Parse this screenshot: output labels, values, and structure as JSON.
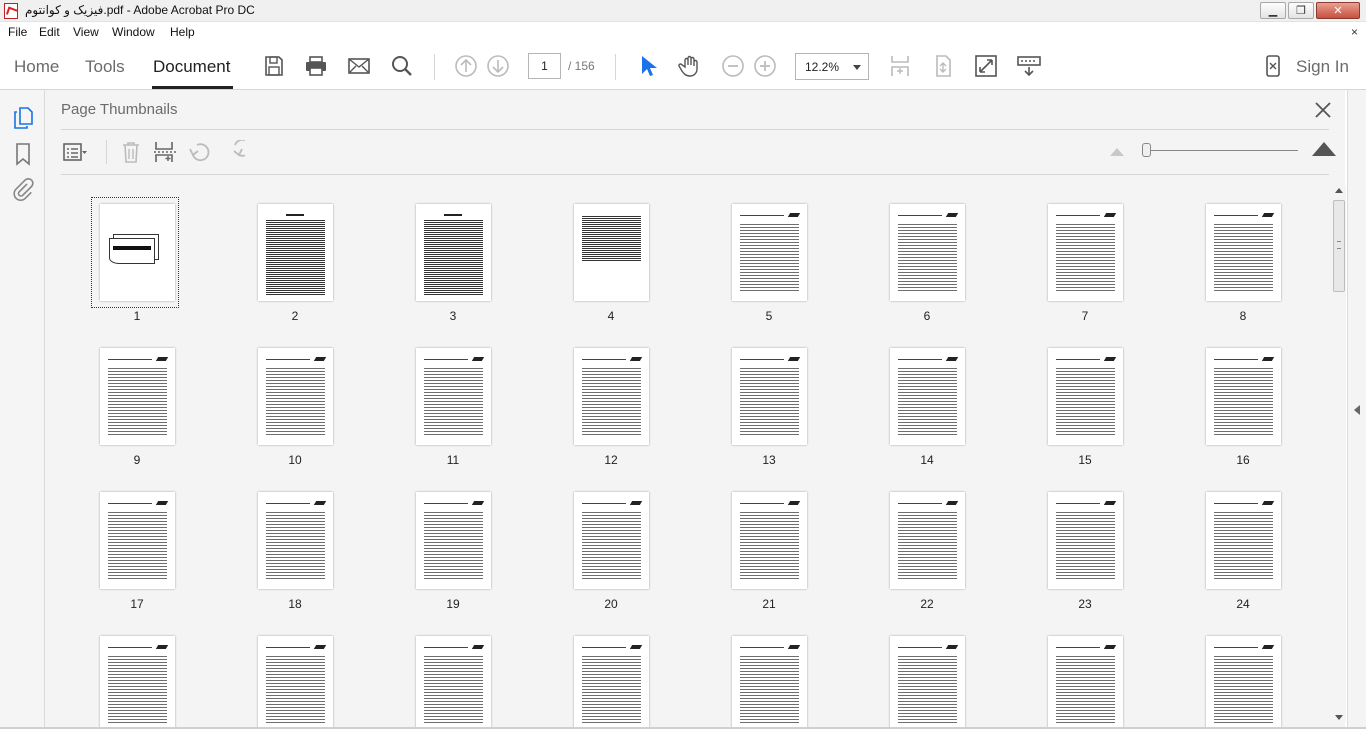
{
  "window": {
    "title": "فیزیک و کوانتوم.pdf - Adobe Acrobat Pro DC",
    "minimize": "▁",
    "maximize": "❐",
    "close": "✕"
  },
  "menubar": {
    "items": [
      "File",
      "Edit",
      "View",
      "Window",
      "Help"
    ],
    "close_glyph": "×"
  },
  "toolbar": {
    "tabs": [
      "Home",
      "Tools",
      "Document"
    ],
    "active_tab": "Document",
    "current_page": "1",
    "total_pages": "/ 156",
    "zoom": "12.2%",
    "sign_in": "Sign In",
    "icons": [
      "save-icon",
      "print-icon",
      "email-icon",
      "search-icon",
      "page-up-icon",
      "page-down-icon",
      "select-cursor-icon",
      "hand-tool-icon",
      "zoom-out-icon",
      "zoom-in-icon",
      "fit-page-icon",
      "page-scroll-icon",
      "full-screen-icon",
      "read-mode-icon",
      "mobile-icon"
    ]
  },
  "panel": {
    "title": "Page Thumbnails",
    "tools": [
      "options-icon",
      "delete-icon",
      "insert-pages-icon",
      "rotate-left-icon",
      "rotate-right-icon"
    ],
    "zoom_slider": 0.0
  },
  "thumbnails": [
    {
      "num": "1",
      "kind": "cover"
    },
    {
      "num": "2",
      "kind": "dense"
    },
    {
      "num": "3",
      "kind": "dense"
    },
    {
      "num": "4",
      "kind": "dense-short"
    },
    {
      "num": "5",
      "kind": "text"
    },
    {
      "num": "6",
      "kind": "text"
    },
    {
      "num": "7",
      "kind": "text"
    },
    {
      "num": "8",
      "kind": "text"
    },
    {
      "num": "9",
      "kind": "text"
    },
    {
      "num": "10",
      "kind": "text"
    },
    {
      "num": "11",
      "kind": "text"
    },
    {
      "num": "12",
      "kind": "text"
    },
    {
      "num": "13",
      "kind": "text"
    },
    {
      "num": "14",
      "kind": "text"
    },
    {
      "num": "15",
      "kind": "text"
    },
    {
      "num": "16",
      "kind": "text"
    },
    {
      "num": "17",
      "kind": "text"
    },
    {
      "num": "18",
      "kind": "text"
    },
    {
      "num": "19",
      "kind": "text"
    },
    {
      "num": "20",
      "kind": "text"
    },
    {
      "num": "21",
      "kind": "text"
    },
    {
      "num": "22",
      "kind": "text"
    },
    {
      "num": "23",
      "kind": "text"
    },
    {
      "num": "24",
      "kind": "text"
    },
    {
      "num": "",
      "kind": "text"
    },
    {
      "num": "",
      "kind": "text"
    },
    {
      "num": "",
      "kind": "text"
    },
    {
      "num": "",
      "kind": "text"
    },
    {
      "num": "",
      "kind": "text"
    },
    {
      "num": "",
      "kind": "text"
    },
    {
      "num": "",
      "kind": "text"
    },
    {
      "num": "",
      "kind": "text"
    }
  ],
  "selected_page": "1"
}
